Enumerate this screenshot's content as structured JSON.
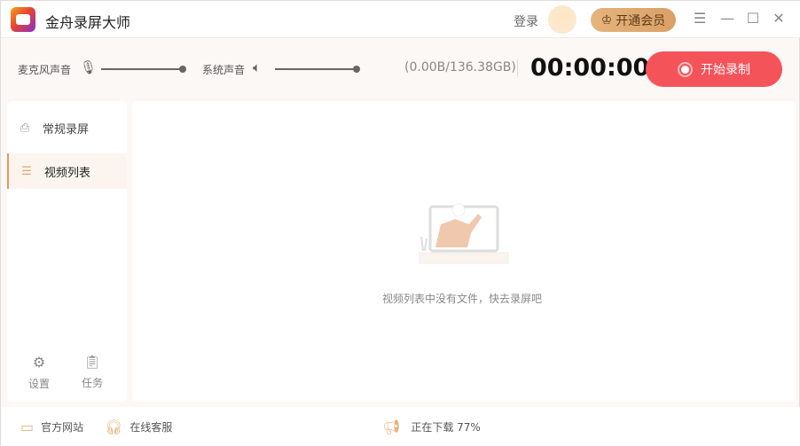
{
  "app": {
    "title": "金舟录屏大师"
  },
  "header": {
    "login": "登录",
    "vip": "开通会员"
  },
  "toolbar": {
    "mic_label": "麦克风声音",
    "mic_level": 1.0,
    "sys_label": "系统声音",
    "sys_level": 1.0,
    "storage": "(0.00B/136.38GB)",
    "timer": "00:00:00",
    "record": "开始录制"
  },
  "sidebar": {
    "items": [
      {
        "label": "常规录屏"
      },
      {
        "label": "视频列表"
      }
    ],
    "settings": "设置",
    "tasks": "任务"
  },
  "main": {
    "empty": "视频列表中没有文件，快去录屏吧"
  },
  "footer": {
    "website": "官方网站",
    "support": "在线客服",
    "download": "正在下载 77%"
  }
}
